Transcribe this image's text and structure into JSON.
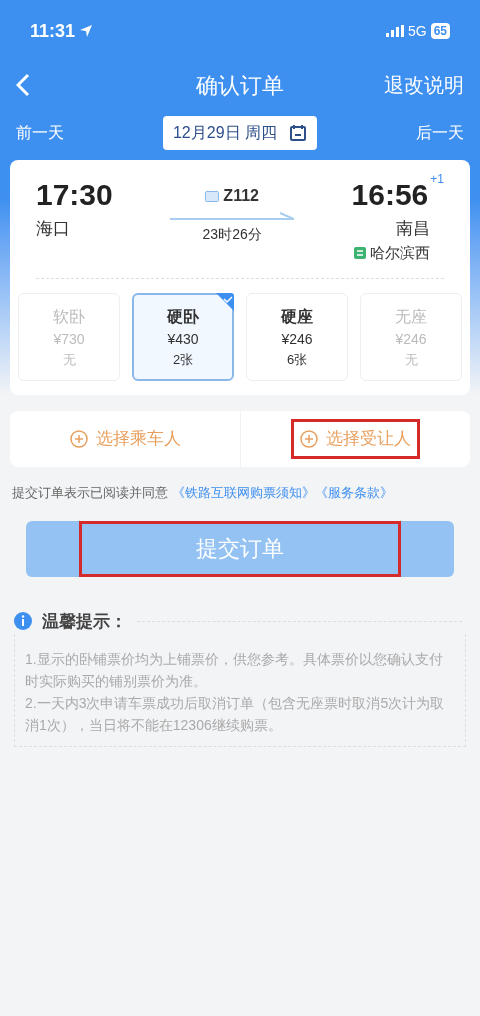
{
  "status_bar": {
    "time": "11:31",
    "network": "5G",
    "battery": "65"
  },
  "nav": {
    "title": "确认订单",
    "action": "退改说明"
  },
  "date_bar": {
    "prev": "前一天",
    "date": "12月29日 周四",
    "next": "后一天"
  },
  "train": {
    "depart_time": "17:30",
    "depart_station": "海口",
    "number": "Z112",
    "duration": "23时26分",
    "arrive_time": "16:56",
    "day_offset": "+1",
    "arrive_station": "南昌",
    "terminal": "哈尔滨西"
  },
  "seats": [
    {
      "name": "软卧",
      "price": "¥730",
      "count": "无",
      "available": false,
      "selected": false
    },
    {
      "name": "硬卧",
      "price": "¥430",
      "count": "2张",
      "available": true,
      "selected": true
    },
    {
      "name": "硬座",
      "price": "¥246",
      "count": "6张",
      "available": true,
      "selected": false
    },
    {
      "name": "无座",
      "price": "¥246",
      "count": "无",
      "available": false,
      "selected": false
    }
  ],
  "passenger_buttons": [
    {
      "label": "选择乘车人",
      "highlighted": false
    },
    {
      "label": "选择受让人",
      "highlighted": true
    }
  ],
  "agreement": {
    "text": "提交订单表示已阅读并同意",
    "links": [
      "《铁路互联网购票须知》",
      "《服务条款》"
    ]
  },
  "submit": {
    "label": "提交订单",
    "highlighted": true
  },
  "tips": {
    "title": "温馨提示：",
    "items": [
      "1.显示的卧铺票价均为上铺票价，供您参考。具体票价以您确认支付时实际购买的铺别票价为准。",
      "2.一天内3次申请车票成功后取消订单（包含无座票时取消5次计为取消1次），当日将不能在12306继续购票。"
    ]
  }
}
